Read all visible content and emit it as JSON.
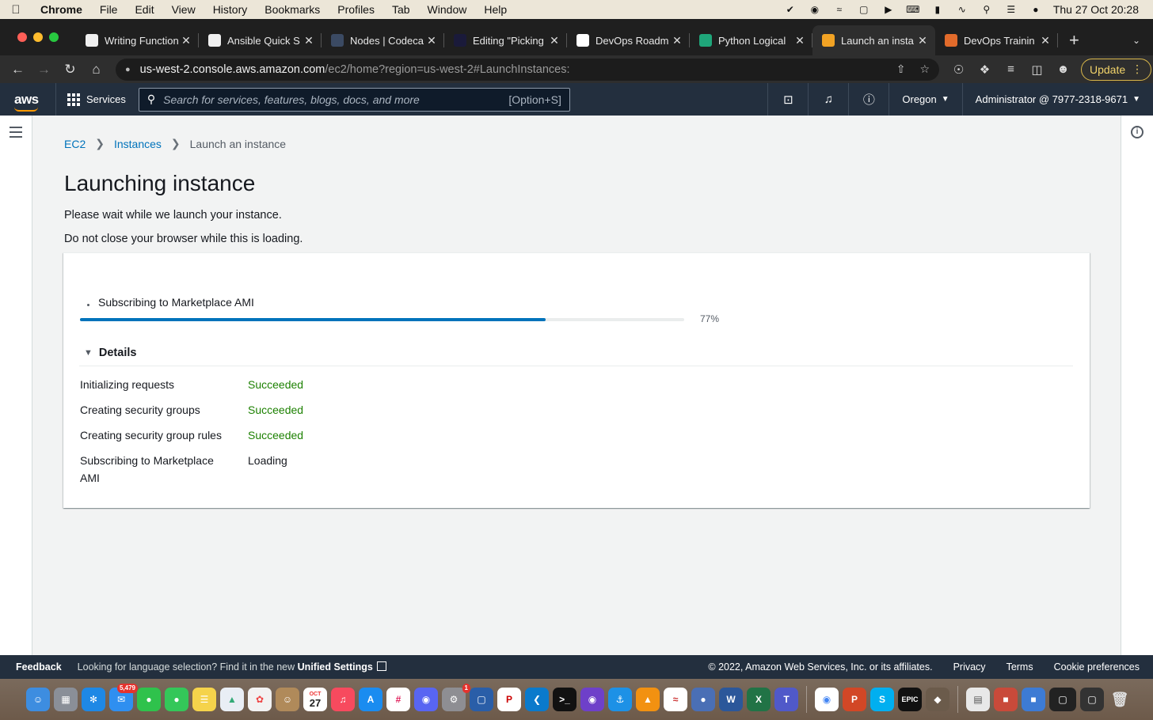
{
  "menubar": {
    "app_name": "Chrome",
    "items": [
      "File",
      "Edit",
      "View",
      "History",
      "Bookmarks",
      "Profiles",
      "Tab",
      "Window",
      "Help"
    ],
    "datetime": "Thu 27 Oct  20:28"
  },
  "tabs": [
    {
      "title": "Writing Function",
      "favicon_color": "#f0f0f0"
    },
    {
      "title": "Ansible Quick S",
      "favicon_color": "#f0f0f0"
    },
    {
      "title": "Nodes | Codeca",
      "favicon_color": "#3b4a63"
    },
    {
      "title": "Editing \"Picking",
      "favicon_color": "#1a1a3a"
    },
    {
      "title": "DevOps Roadm",
      "favicon_color": "#ffffff"
    },
    {
      "title": "Python Logical",
      "favicon_color": "#1fa67a"
    },
    {
      "title": "Launch an insta",
      "favicon_color": "#f2a324",
      "active": true
    },
    {
      "title": "DevOps Trainin",
      "favicon_color": "#e26b2b"
    }
  ],
  "toolbar": {
    "url_host": "us-west-2.console.aws.amazon.com",
    "url_path": "/ec2/home?region=us-west-2#LaunchInstances:",
    "update_label": "Update"
  },
  "aws_header": {
    "logo": "aws",
    "services_label": "Services",
    "search_placeholder": "Search for services, features, blogs, docs, and more",
    "search_shortcut": "[Option+S]",
    "region": "Oregon",
    "account": "Administrator @ 7977-2318-9671"
  },
  "breadcrumb": {
    "ec2": "EC2",
    "instances": "Instances",
    "current": "Launch an instance"
  },
  "page": {
    "title": "Launching instance",
    "wait_text": "Please wait while we launch your instance.",
    "close_text": "Do not close your browser while this is loading."
  },
  "progress": {
    "current_step": "Subscribing to Marketplace AMI",
    "percent": 77,
    "percent_label": "77%"
  },
  "details": {
    "toggle_label": "Details",
    "rows": [
      {
        "label": "Initializing requests",
        "status": "Succeeded"
      },
      {
        "label": "Creating security groups",
        "status": "Succeeded"
      },
      {
        "label": "Creating security group rules",
        "status": "Succeeded"
      },
      {
        "label": "Subscribing to Marketplace AMI",
        "status": "Loading"
      }
    ]
  },
  "footer": {
    "feedback": "Feedback",
    "language_text": "Looking for language selection? Find it in the new",
    "unified_settings": "Unified Settings",
    "copyright": "© 2022, Amazon Web Services, Inc. or its affiliates.",
    "privacy": "Privacy",
    "terms": "Terms",
    "cookie": "Cookie preferences"
  },
  "dock": {
    "mail_badge": "5,479",
    "settings_badge": "1",
    "calendar_month": "OCT",
    "calendar_day": "27",
    "epic_label": "EPIC"
  },
  "colors": {
    "aws_nav": "#232f3e",
    "aws_orange": "#ff9900",
    "link_blue": "#0073bb",
    "success_green": "#1d8102"
  }
}
